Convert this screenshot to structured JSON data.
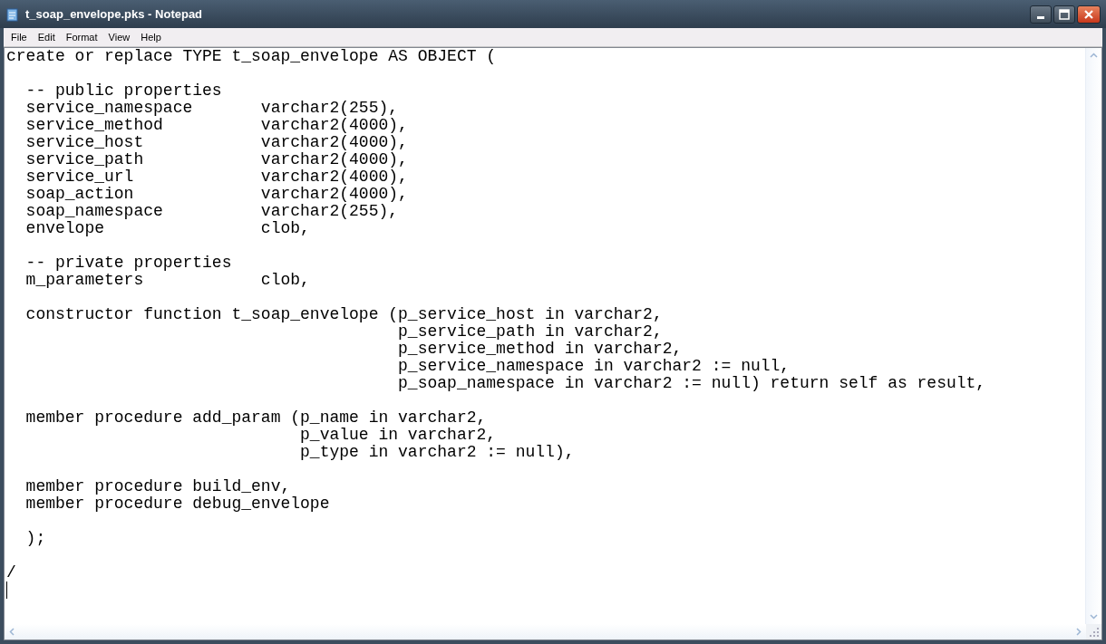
{
  "window": {
    "title": "t_soap_envelope.pks - Notepad"
  },
  "menu": [
    "File",
    "Edit",
    "Format",
    "View",
    "Help"
  ],
  "editor": {
    "blocks": [
      [
        "create or replace TYPE t_soap_envelope AS OBJECT ("
      ],
      [
        "  -- public properties",
        "  service_namespace       varchar2(255),",
        "  service_method          varchar2(4000),",
        "  service_host            varchar2(4000),",
        "  service_path            varchar2(4000),",
        "  service_url             varchar2(4000),",
        "  soap_action             varchar2(4000),",
        "  soap_namespace          varchar2(255),",
        "  envelope                clob,"
      ],
      [
        "  -- private properties",
        "  m_parameters            clob,"
      ],
      [
        "  constructor function t_soap_envelope (p_service_host in varchar2,",
        "                                        p_service_path in varchar2,",
        "                                        p_service_method in varchar2,",
        "                                        p_service_namespace in varchar2 := null,",
        "                                        p_soap_namespace in varchar2 := null) return self as result,"
      ],
      [
        "  member procedure add_param (p_name in varchar2,",
        "                              p_value in varchar2,",
        "                              p_type in varchar2 := null),"
      ],
      [
        "  member procedure build_env,",
        "  member procedure debug_envelope"
      ],
      [
        "  );"
      ],
      [
        "/"
      ]
    ]
  }
}
